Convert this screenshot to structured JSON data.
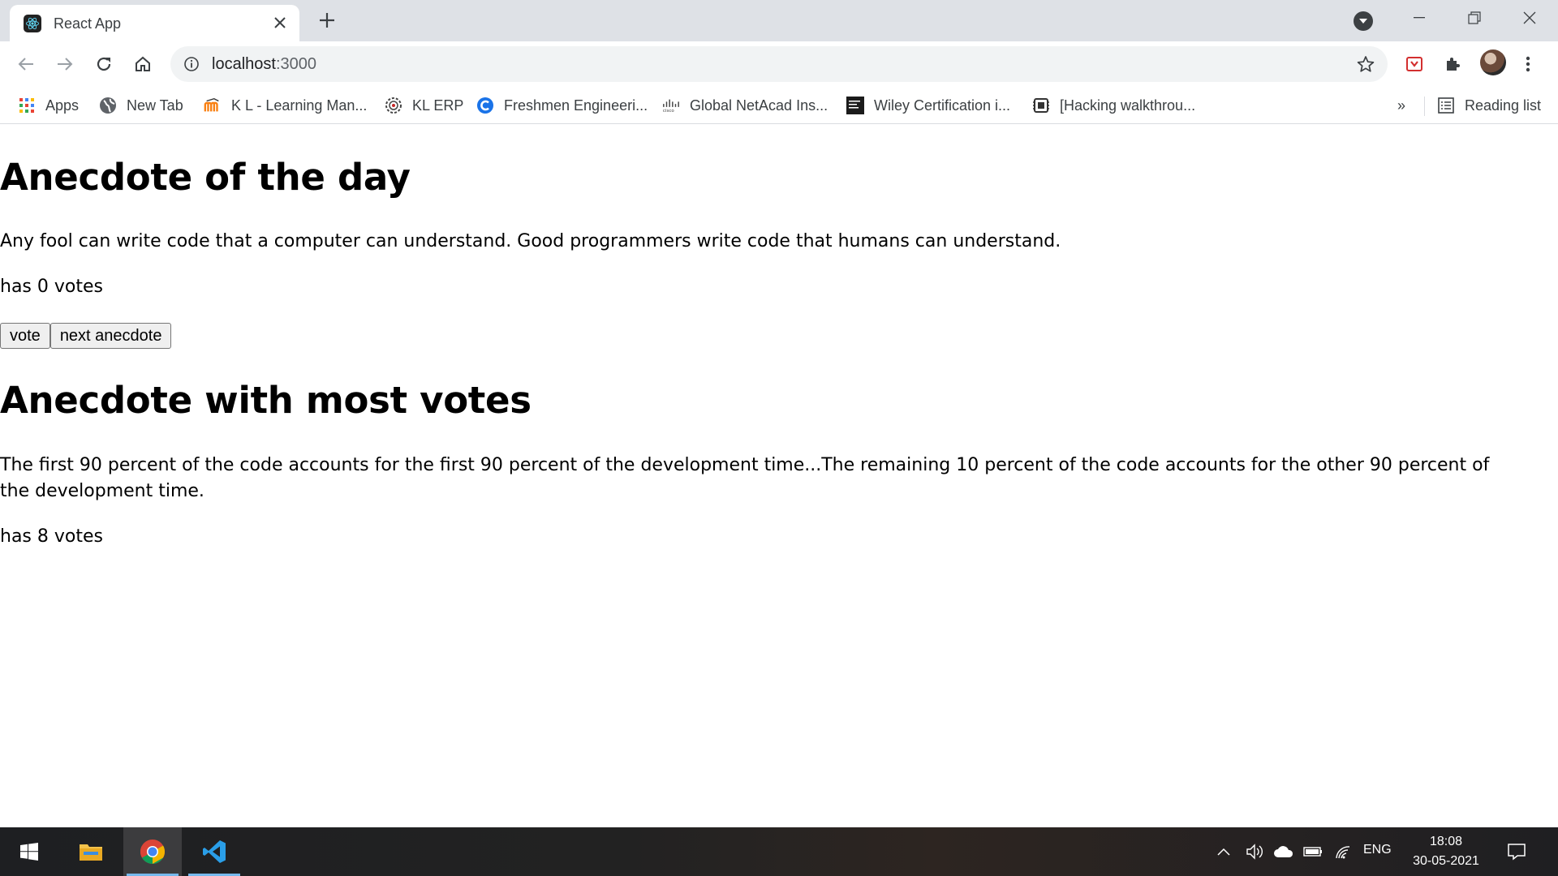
{
  "browser": {
    "tab": {
      "title": "React App"
    },
    "address": {
      "host": "localhost",
      "port": ":3000"
    },
    "bookmarks": [
      {
        "label": "Apps",
        "icon": "apps-grid-icon"
      },
      {
        "label": "New Tab",
        "icon": "globe-icon"
      },
      {
        "label": "K L - Learning Man...",
        "icon": "moodle-icon"
      },
      {
        "label": "KL ERP",
        "icon": "gear-badge-icon"
      },
      {
        "label": "Freshmen Engineeri...",
        "icon": "c-logo-icon"
      },
      {
        "label": "Global NetAcad Ins...",
        "icon": "cisco-icon"
      },
      {
        "label": "Wiley Certification i...",
        "icon": "wiley-icon"
      },
      {
        "label": "[Hacking walkthrou...",
        "icon": "chip-icon"
      }
    ],
    "bookmarks_more": "»",
    "reading_list": "Reading list"
  },
  "page": {
    "heading_day": "Anecdote of the day",
    "anecdote_day": "Any fool can write code that a computer can understand. Good programmers write code that humans can understand.",
    "votes_day": "has 0 votes",
    "vote_button": "vote",
    "next_button": "next anecdote",
    "heading_most": "Anecdote with most votes",
    "anecdote_most": "The first 90 percent of the code accounts for the first 90 percent of the development time...The remaining 10 percent of the code accounts for the other 90 percent of the development time.",
    "votes_most": "has 8 votes"
  },
  "taskbar": {
    "language": "ENG",
    "time": "18:08",
    "date": "30-05-2021"
  },
  "colors": {
    "tabstrip": "#dee1e6",
    "omnibox": "#f1f3f4",
    "taskbar": "#1e1f22",
    "accent": "#76b9ed"
  }
}
